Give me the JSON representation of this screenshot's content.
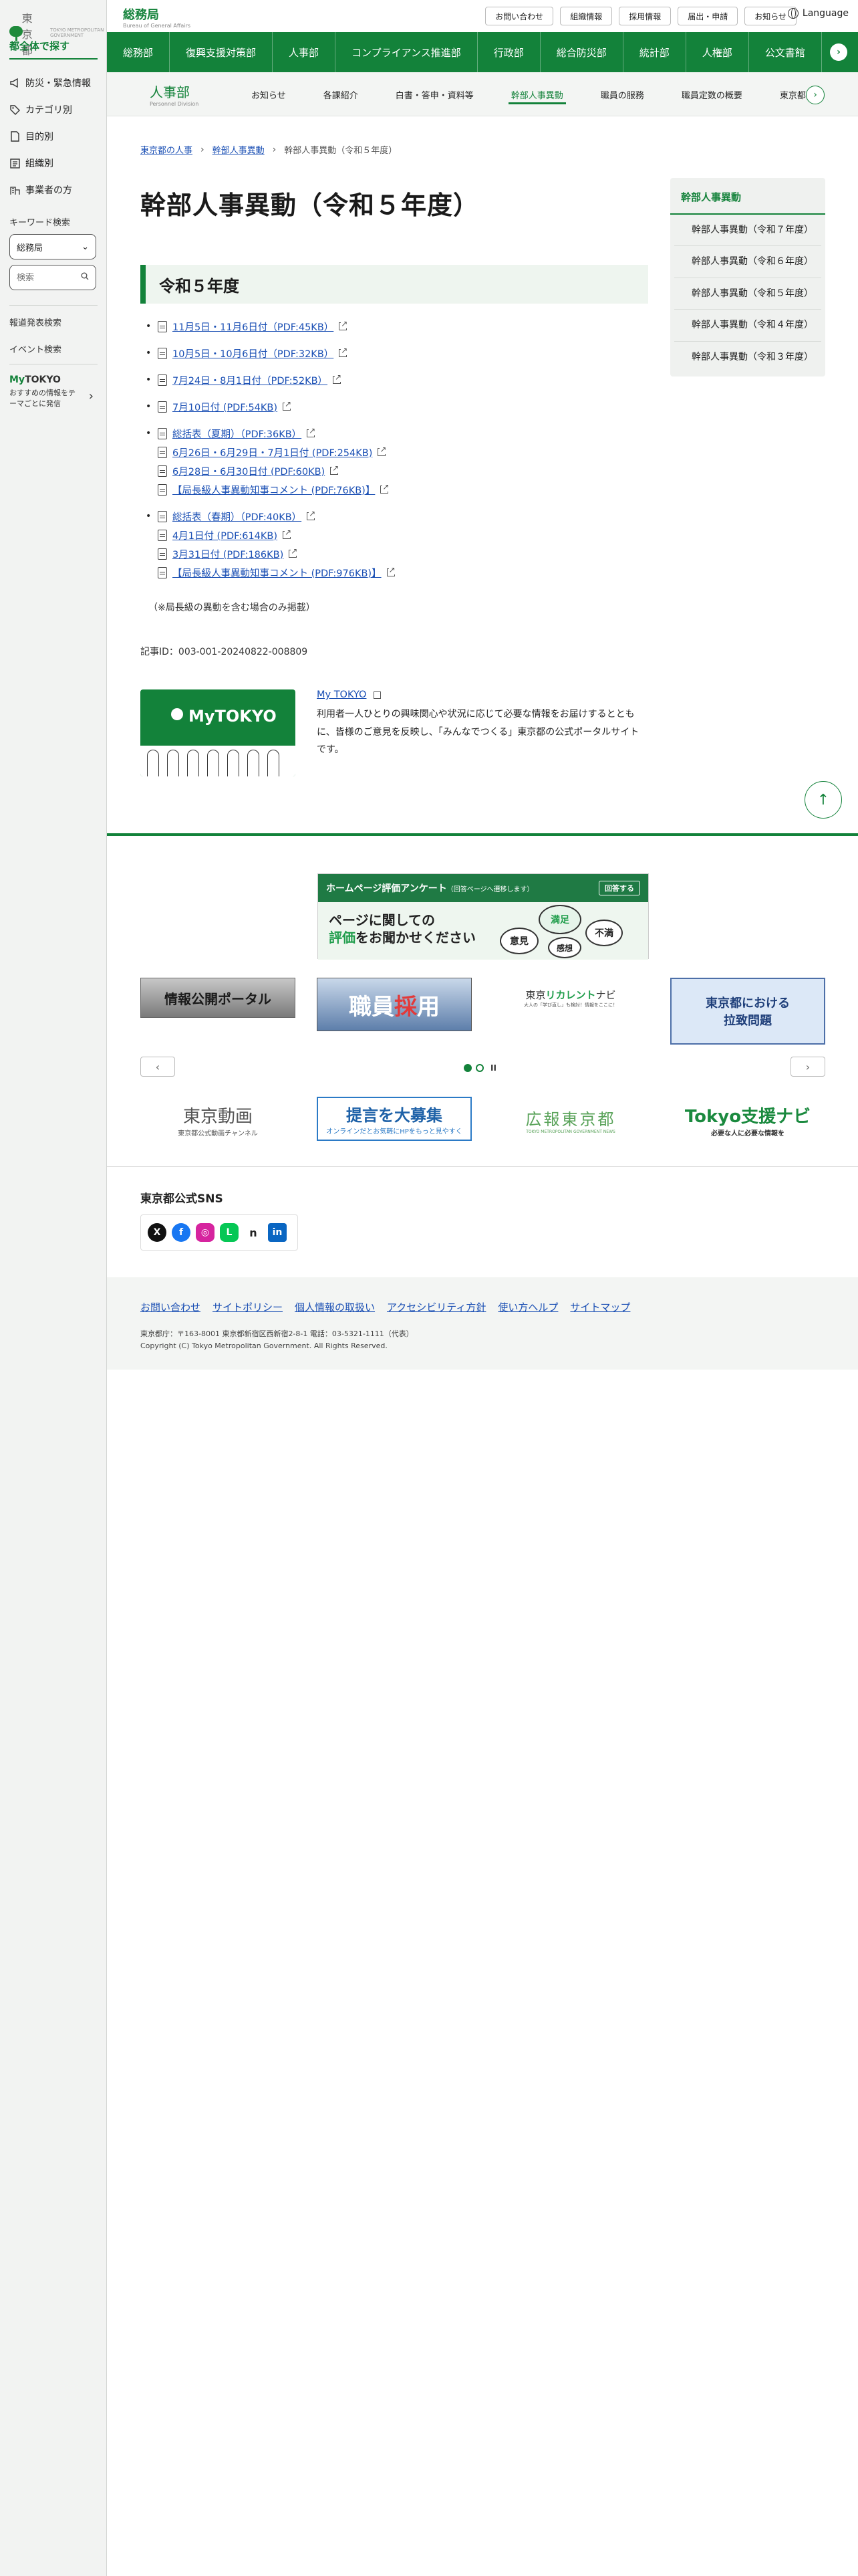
{
  "sidebar": {
    "logo": "東京都",
    "logo_sub": "TOKYO METROPOLITAN GOVERNMENT",
    "heading": "都全体で探す",
    "items": [
      {
        "label": "防災・緊急情報",
        "icon": "megaphone-icon"
      },
      {
        "label": "カテゴリ別",
        "icon": "tag-icon"
      },
      {
        "label": "目的別",
        "icon": "document-icon"
      },
      {
        "label": "組織別",
        "icon": "org-chart-icon"
      },
      {
        "label": "事業者の方",
        "icon": "building-icon"
      }
    ],
    "keyword_label": "キーワード検索",
    "select_value": "総務局",
    "search_placeholder": "検索",
    "press_search": "報道発表検索",
    "event_search": "イベント検索",
    "mytokyo_logo_a": "My",
    "mytokyo_logo_b": "TOKYO",
    "mytokyo_desc": "おすすめの情報をテーマごとに発信"
  },
  "header": {
    "bureau": "総務局",
    "bureau_en": "Bureau of General Affairs",
    "links": [
      "お問い合わせ",
      "組織情報",
      "採用情報",
      "届出・申請",
      "お知らせ"
    ],
    "language": "Language"
  },
  "greennav": [
    "総務部",
    "復興支援対策部",
    "人事部",
    "コンプライアンス推進部",
    "行政部",
    "総合防災部",
    "統計部",
    "人権部",
    "公文書館"
  ],
  "subnav": {
    "title": "人事部",
    "title_en": "Personnel Division",
    "items": [
      "お知らせ",
      "各課紹介",
      "白書・答申・資料等",
      "幹部人事異動",
      "職員の服務",
      "職員定数の概要",
      "東京都"
    ],
    "active_index": 3
  },
  "breadcrumb": [
    "東京都の人事",
    "幹部人事異動",
    "幹部人事異動（令和５年度）"
  ],
  "page_title": "幹部人事異動（令和５年度）",
  "section_title": "令和５年度",
  "groups": [
    {
      "items": [
        "11月5日・11月6日付（PDF:45KB）"
      ]
    },
    {
      "items": [
        "10月5日・10月6日付（PDF:32KB）"
      ]
    },
    {
      "items": [
        "7月24日・8月1日付（PDF:52KB）"
      ]
    },
    {
      "items": [
        "7月10日付 (PDF:54KB)"
      ]
    },
    {
      "items": [
        "総括表（夏期）（PDF:36KB）",
        "6月26日・6月29日・7月1日付 (PDF:254KB)",
        "6月28日・6月30日付 (PDF:60KB)",
        "【局長級人事異動知事コメント (PDF:76KB)】"
      ]
    },
    {
      "items": [
        "総括表（春期）（PDF:40KB）",
        "4月1日付 (PDF:614KB)",
        "3月31日付 (PDF:186KB)",
        "【局長級人事異動知事コメント (PDF:976KB)】"
      ]
    }
  ],
  "note": "（※局長級の異動を含む場合のみ掲載）",
  "article_id": "記事ID：003-001-20240822-008809",
  "promo": {
    "img_title": "MyTOKYO",
    "link": "My TOKYO",
    "text": "利用者一人ひとりの興味関心や状況に応じて必要な情報をお届けするとともに、皆様のご意見を反映し、「みんなでつくる」東京都の公式ポータルサイトです。"
  },
  "right_nav": {
    "heading": "幹部人事異動",
    "items": [
      "幹部人事異動（令和７年度）",
      "幹部人事異動（令和６年度）",
      "幹部人事異動（令和５年度）",
      "幹部人事異動（令和４年度）",
      "幹部人事異動（令和３年度）"
    ]
  },
  "survey": {
    "bar_title": "ホームページ評価アンケート",
    "bar_note": "（回答ページへ遷移します）",
    "button": "回答する",
    "q1": "ページに関しての",
    "q2a": "評価",
    "q2b": "をお聞かせください",
    "bubbles": [
      "満足",
      "不満",
      "意見",
      "感想"
    ]
  },
  "carousel": {
    "b1": "情報公開ポータル",
    "b2a": "職員",
    "b2b": "採",
    "b2c": "用",
    "b3a": "東京",
    "b3b": "リカレント",
    "b3c": "ナビ",
    "b3d": "大人の「学び直し」も検討！情報をここに！",
    "b4a": "東京都における",
    "b4b": "拉致問題",
    "prev": "‹",
    "next": "›",
    "pause": "II"
  },
  "banners": {
    "b1": "東京動画",
    "b1s": "東京都公式動画チャンネル",
    "b2": "提言を大募集",
    "b2s": "オンラインだとお気軽にHPをもっと見やすく",
    "b3": "広報東京都",
    "b3s": "TOKYO METROPOLITAN GOVERNMENT NEWS",
    "b4": "Tokyo支援ナビ",
    "b4s": "必要な人に必要な情報を"
  },
  "sns_heading": "東京都公式SNS",
  "sns": [
    {
      "label": "X",
      "icon": "x-icon",
      "color": "#111111"
    },
    {
      "label": "f",
      "icon": "facebook-icon",
      "color": "#1877f2"
    },
    {
      "label": "◎",
      "icon": "instagram-icon",
      "color": "#d6249f"
    },
    {
      "label": "L",
      "icon": "line-icon",
      "color": "#06c755"
    },
    {
      "label": "n",
      "icon": "note-icon",
      "color": "#222222"
    },
    {
      "label": "in",
      "icon": "linkedin-icon",
      "color": "#0a66c2"
    }
  ],
  "footer": {
    "links": [
      "お問い合わせ",
      "サイトポリシー",
      "個人情報の取扱い",
      "アクセシビリティ方針",
      "使い方ヘルプ",
      "サイトマップ"
    ],
    "address": "東京都庁：〒163-8001 東京都新宿区西新宿2-8-1 電話：03-5321-1111（代表）",
    "copyright": "Copyright (C) Tokyo Metropolitan Government. All Rights Reserved."
  }
}
